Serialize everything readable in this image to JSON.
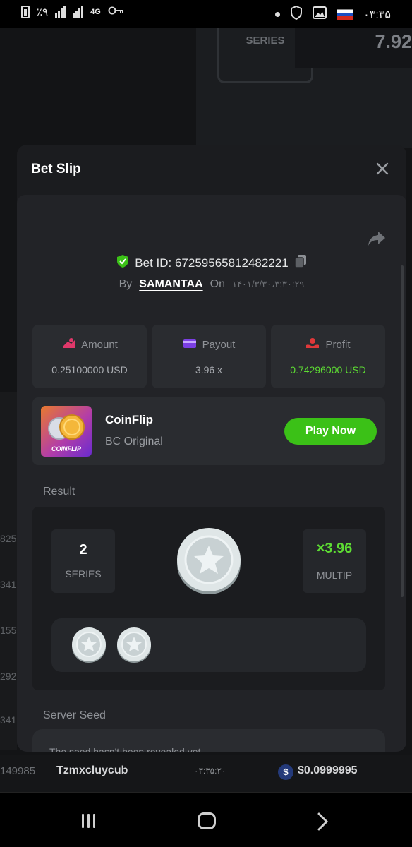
{
  "status_bar": {
    "battery_text": "٪۹",
    "network": "4G",
    "time": "۰۳:۳۵"
  },
  "background": {
    "series_label": "SERIES",
    "multiplier": "7.92",
    "left_numbers": [
      "825",
      "341",
      "155",
      "292",
      "341"
    ],
    "feed_row": {
      "bet_id": "149985",
      "player": "Tzmxcluycub",
      "time": "۰۳:۳۵:۲۰",
      "coin_symbol": "$",
      "amount": "$0.0999995"
    }
  },
  "modal": {
    "title": "Bet Slip",
    "bet_id_label": "Bet ID: 67259565812482221",
    "by_label": "By",
    "username": "SAMANTAA",
    "on_label": "On",
    "datetime": "۱۴۰۱/۳/۳۰،۳:۳۰:۲۹",
    "stats": [
      {
        "label": "Amount",
        "value": "0.25100000 USD",
        "color": "#a9acb1"
      },
      {
        "label": "Payout",
        "value": "3.96 x",
        "color": "#a9acb1"
      },
      {
        "label": "Profit",
        "value": "0.74296000 USD",
        "color": "#5ddc33"
      }
    ],
    "game": {
      "thumb_label": "COINFLIP",
      "name": "CoinFlip",
      "subtitle": "BC Original",
      "play_label": "Play Now"
    },
    "result": {
      "section_label": "Result",
      "series_value": "2",
      "series_label": "SERIES",
      "multiplier_value": "×3.96",
      "multiplier_label": "MULTIP"
    },
    "server_seed": {
      "section_label": "Server Seed",
      "text": "The seed hasn't been revealed yet"
    }
  },
  "colors": {
    "accent_green": "#3bc117",
    "profit_green": "#5ddc33",
    "modal_bg": "#1b1c1f"
  }
}
